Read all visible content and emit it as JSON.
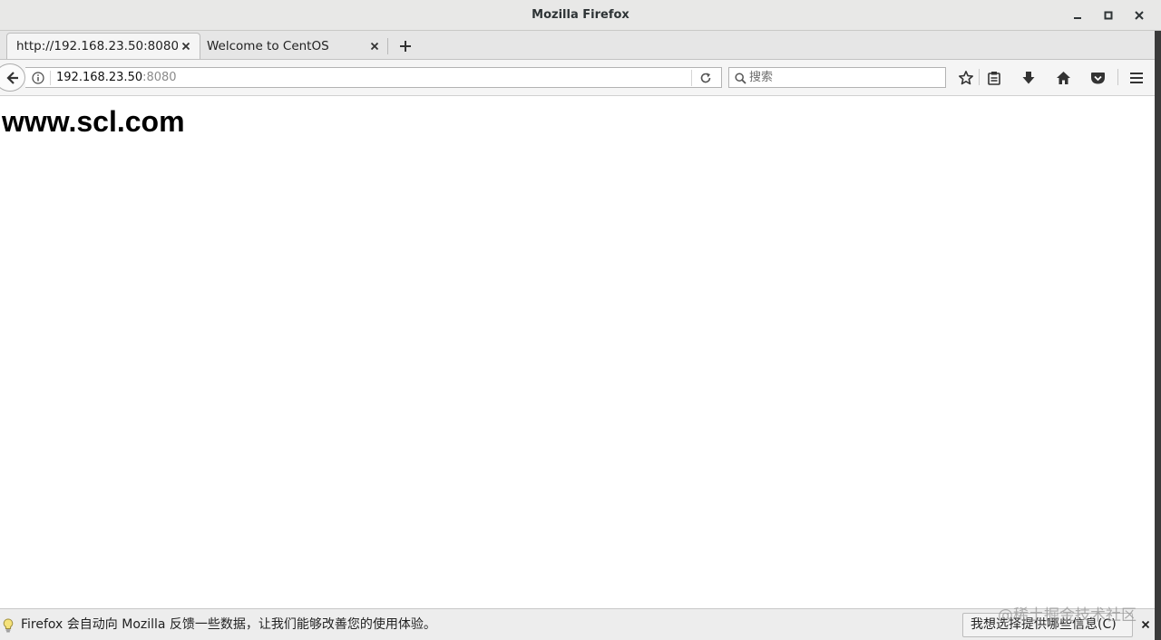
{
  "window": {
    "title": "Mozilla Firefox"
  },
  "tabs": [
    {
      "label": "http://192.168.23.50:8080/",
      "active": true
    },
    {
      "label": "Welcome to CentOS",
      "active": false
    }
  ],
  "navbar": {
    "url_host": "192.168.23.50",
    "url_port": ":8080",
    "search_placeholder": "搜索"
  },
  "page": {
    "heading": "www.scl.com"
  },
  "notification": {
    "message": "Firefox 会自动向 Mozilla 反馈一些数据，让我们能够改善您的使用体验。",
    "action_label": "我想选择提供哪些信息(C)"
  },
  "watermark": "@稀土掘金技术社区",
  "icons": {
    "minimize": "minimize-icon",
    "maximize": "maximize-icon",
    "close": "close-icon",
    "back": "back-arrow-icon",
    "info": "info-icon",
    "reload": "reload-icon",
    "search": "search-icon",
    "bookmark": "star-icon",
    "library": "clipboard-icon",
    "download": "download-icon",
    "home": "home-icon",
    "pocket": "pocket-icon",
    "menu": "hamburger-menu-icon",
    "tip": "lightbulb-icon"
  },
  "colors": {
    "titlebar": "#e8e8e7",
    "toolbar": "#f5f5f5",
    "notification": "#ededed"
  }
}
